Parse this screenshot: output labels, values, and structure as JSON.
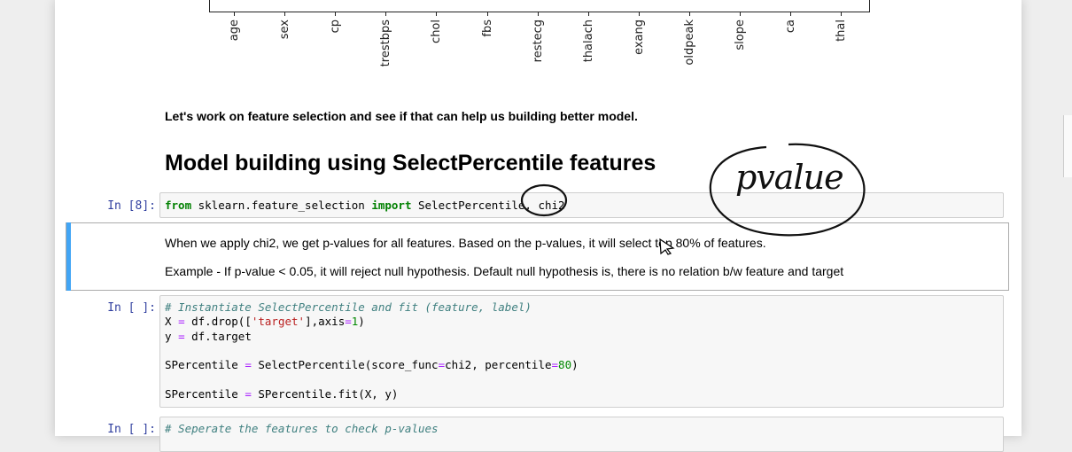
{
  "chart": {
    "tick_labels": [
      "age",
      "sex",
      "cp",
      "trestbps",
      "chol",
      "fbs",
      "restecg",
      "thalach",
      "exang",
      "oldpeak",
      "slope",
      "ca",
      "thal"
    ]
  },
  "markdown1": {
    "text": "Let's work on feature selection and see if that can help us building better model."
  },
  "heading": {
    "text": "Model building using SelectPercentile features"
  },
  "cell1": {
    "prompt": "In [8]:",
    "code": {
      "kw1": "from",
      "mod": " sklearn.feature_selection ",
      "kw2": "import",
      "rest": " SelectPercentile, ",
      "chi2": "chi2"
    }
  },
  "markdown2": {
    "line1": "When we apply chi2, we get p-values for all features. Based on the p-values, it will select top 80% of features.",
    "line2": "Example - If p-value < 0.05, it will reject null hypothesis. Default null hypothesis is, there is no relation b/w feature and target"
  },
  "cell2": {
    "prompt": "In [ ]:",
    "lines": {
      "l1": "# Instantiate SelectPercentile and fit (feature, label)",
      "l2a": "X ",
      "l2op": "=",
      "l2b": " df.drop([",
      "l2str": "'target'",
      "l2c": "],axis",
      "l2op2": "=",
      "l2num": "1",
      "l2d": ")",
      "l3a": "y ",
      "l3op": "=",
      "l3b": " df.target",
      "l5a": "SPercentile ",
      "l5op": "=",
      "l5b": " SelectPercentile(score_func",
      "l5op2": "=",
      "l5c": "chi2, percentile",
      "l5op3": "=",
      "l5num": "80",
      "l5d": ")",
      "l7a": "SPercentile ",
      "l7op": "=",
      "l7b": " SPercentile.fit(X, y)"
    }
  },
  "cell3": {
    "prompt": "In [ ]:",
    "code": "# Seperate the features to check p-values"
  },
  "annotation": {
    "text": "pvalue"
  }
}
